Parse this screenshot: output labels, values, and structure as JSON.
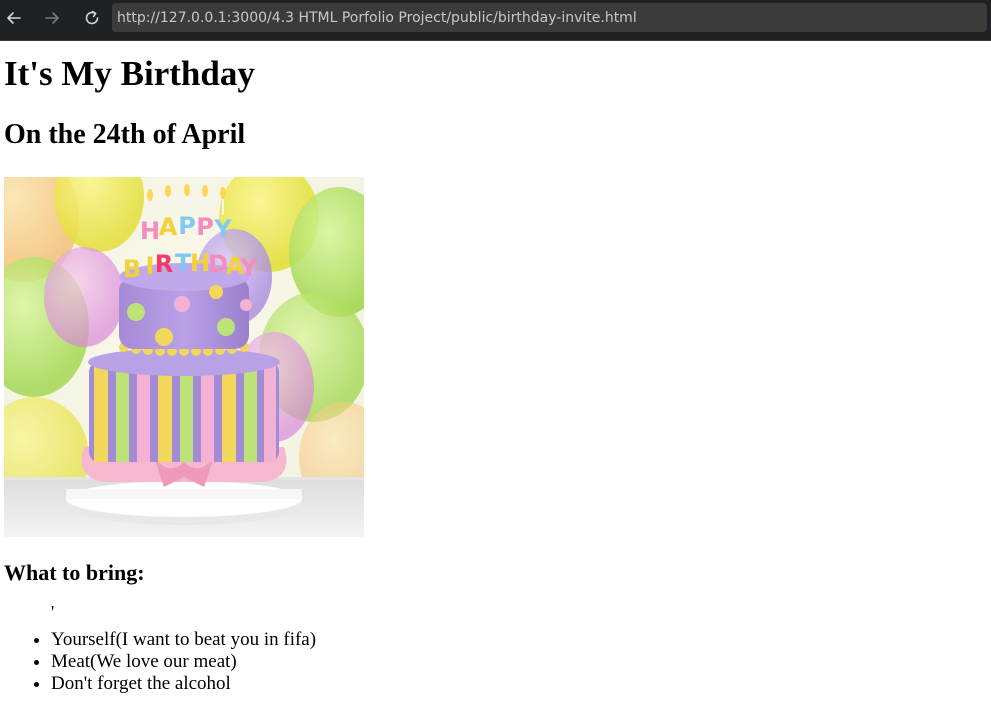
{
  "browser": {
    "url": "http://127.0.0.1:3000/4.3 HTML Porfolio Project/public/birthday-invite.html",
    "back_icon": "arrow-left-icon",
    "forward_icon": "arrow-right-icon",
    "reload_icon": "reload-icon"
  },
  "page": {
    "title": "It's My Birthday",
    "date": "On the 24th of April",
    "image": {
      "description_icon": "birthday-cake-image",
      "cake_topper": [
        "H",
        "A",
        "P",
        "P",
        "Y",
        "B",
        "I",
        "R",
        "T",
        "H",
        "D",
        "A",
        "Y"
      ]
    },
    "bring_heading": "What to bring:",
    "stray_char": "'",
    "items": [
      "Yourself(I want to beat you in fifa)",
      "Meat(We love our meat)",
      "Don't forget the alcohol"
    ]
  },
  "colors": {
    "toolbar_bg": "#202124",
    "url_bg": "#3b3b3b",
    "url_text": "#c8c8c8"
  }
}
